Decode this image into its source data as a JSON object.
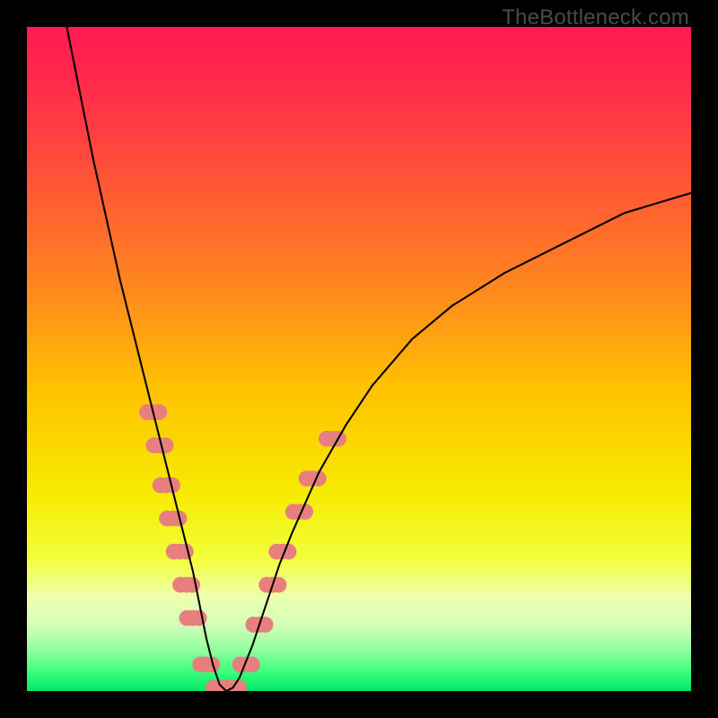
{
  "watermark": "TheBottleneck.com",
  "chart_data": {
    "type": "line",
    "title": "",
    "xlabel": "",
    "ylabel": "",
    "xlim": [
      0,
      100
    ],
    "ylim": [
      0,
      100
    ],
    "grid": false,
    "legend": false,
    "gradient_stops": [
      {
        "offset": 0.0,
        "color": "#ff1a52"
      },
      {
        "offset": 0.1,
        "color": "#ff2e49"
      },
      {
        "offset": 0.25,
        "color": "#ff5a34"
      },
      {
        "offset": 0.4,
        "color": "#ff8a1e"
      },
      {
        "offset": 0.55,
        "color": "#ffc300"
      },
      {
        "offset": 0.7,
        "color": "#f6ea00"
      },
      {
        "offset": 0.8,
        "color": "#f2ff3a"
      },
      {
        "offset": 0.86,
        "color": "#ecffb0"
      },
      {
        "offset": 0.9,
        "color": "#d4ffb8"
      },
      {
        "offset": 0.94,
        "color": "#8eff9e"
      },
      {
        "offset": 0.97,
        "color": "#3eff7d"
      },
      {
        "offset": 1.0,
        "color": "#00e765"
      }
    ],
    "series": [
      {
        "name": "bottleneck-curve",
        "color": "#000000",
        "x": [
          6,
          8,
          10,
          12,
          14,
          16,
          18,
          20,
          22,
          23,
          24,
          25,
          26,
          27,
          28,
          29,
          30,
          31,
          32,
          34,
          36,
          38,
          40,
          44,
          48,
          52,
          58,
          64,
          72,
          80,
          90,
          100
        ],
        "y": [
          100,
          90,
          80,
          71,
          62,
          54,
          46,
          38,
          30,
          26,
          22,
          18,
          13,
          8,
          4,
          1,
          0,
          0.5,
          2,
          7,
          13,
          19,
          24,
          33,
          40,
          46,
          53,
          58,
          63,
          67,
          72,
          75
        ]
      }
    ],
    "markers": {
      "name": "highlight-dots",
      "color": "#e77f7f",
      "radius_pct": 1.2,
      "points": [
        {
          "x": 19,
          "y": 42
        },
        {
          "x": 20,
          "y": 37
        },
        {
          "x": 21,
          "y": 31
        },
        {
          "x": 22,
          "y": 26
        },
        {
          "x": 23,
          "y": 21
        },
        {
          "x": 24,
          "y": 16
        },
        {
          "x": 25,
          "y": 11
        },
        {
          "x": 27,
          "y": 4
        },
        {
          "x": 29,
          "y": 0.5
        },
        {
          "x": 31,
          "y": 0.5
        },
        {
          "x": 33,
          "y": 4
        },
        {
          "x": 35,
          "y": 10
        },
        {
          "x": 37,
          "y": 16
        },
        {
          "x": 38.5,
          "y": 21
        },
        {
          "x": 41,
          "y": 27
        },
        {
          "x": 43,
          "y": 32
        },
        {
          "x": 46,
          "y": 38
        }
      ]
    }
  }
}
